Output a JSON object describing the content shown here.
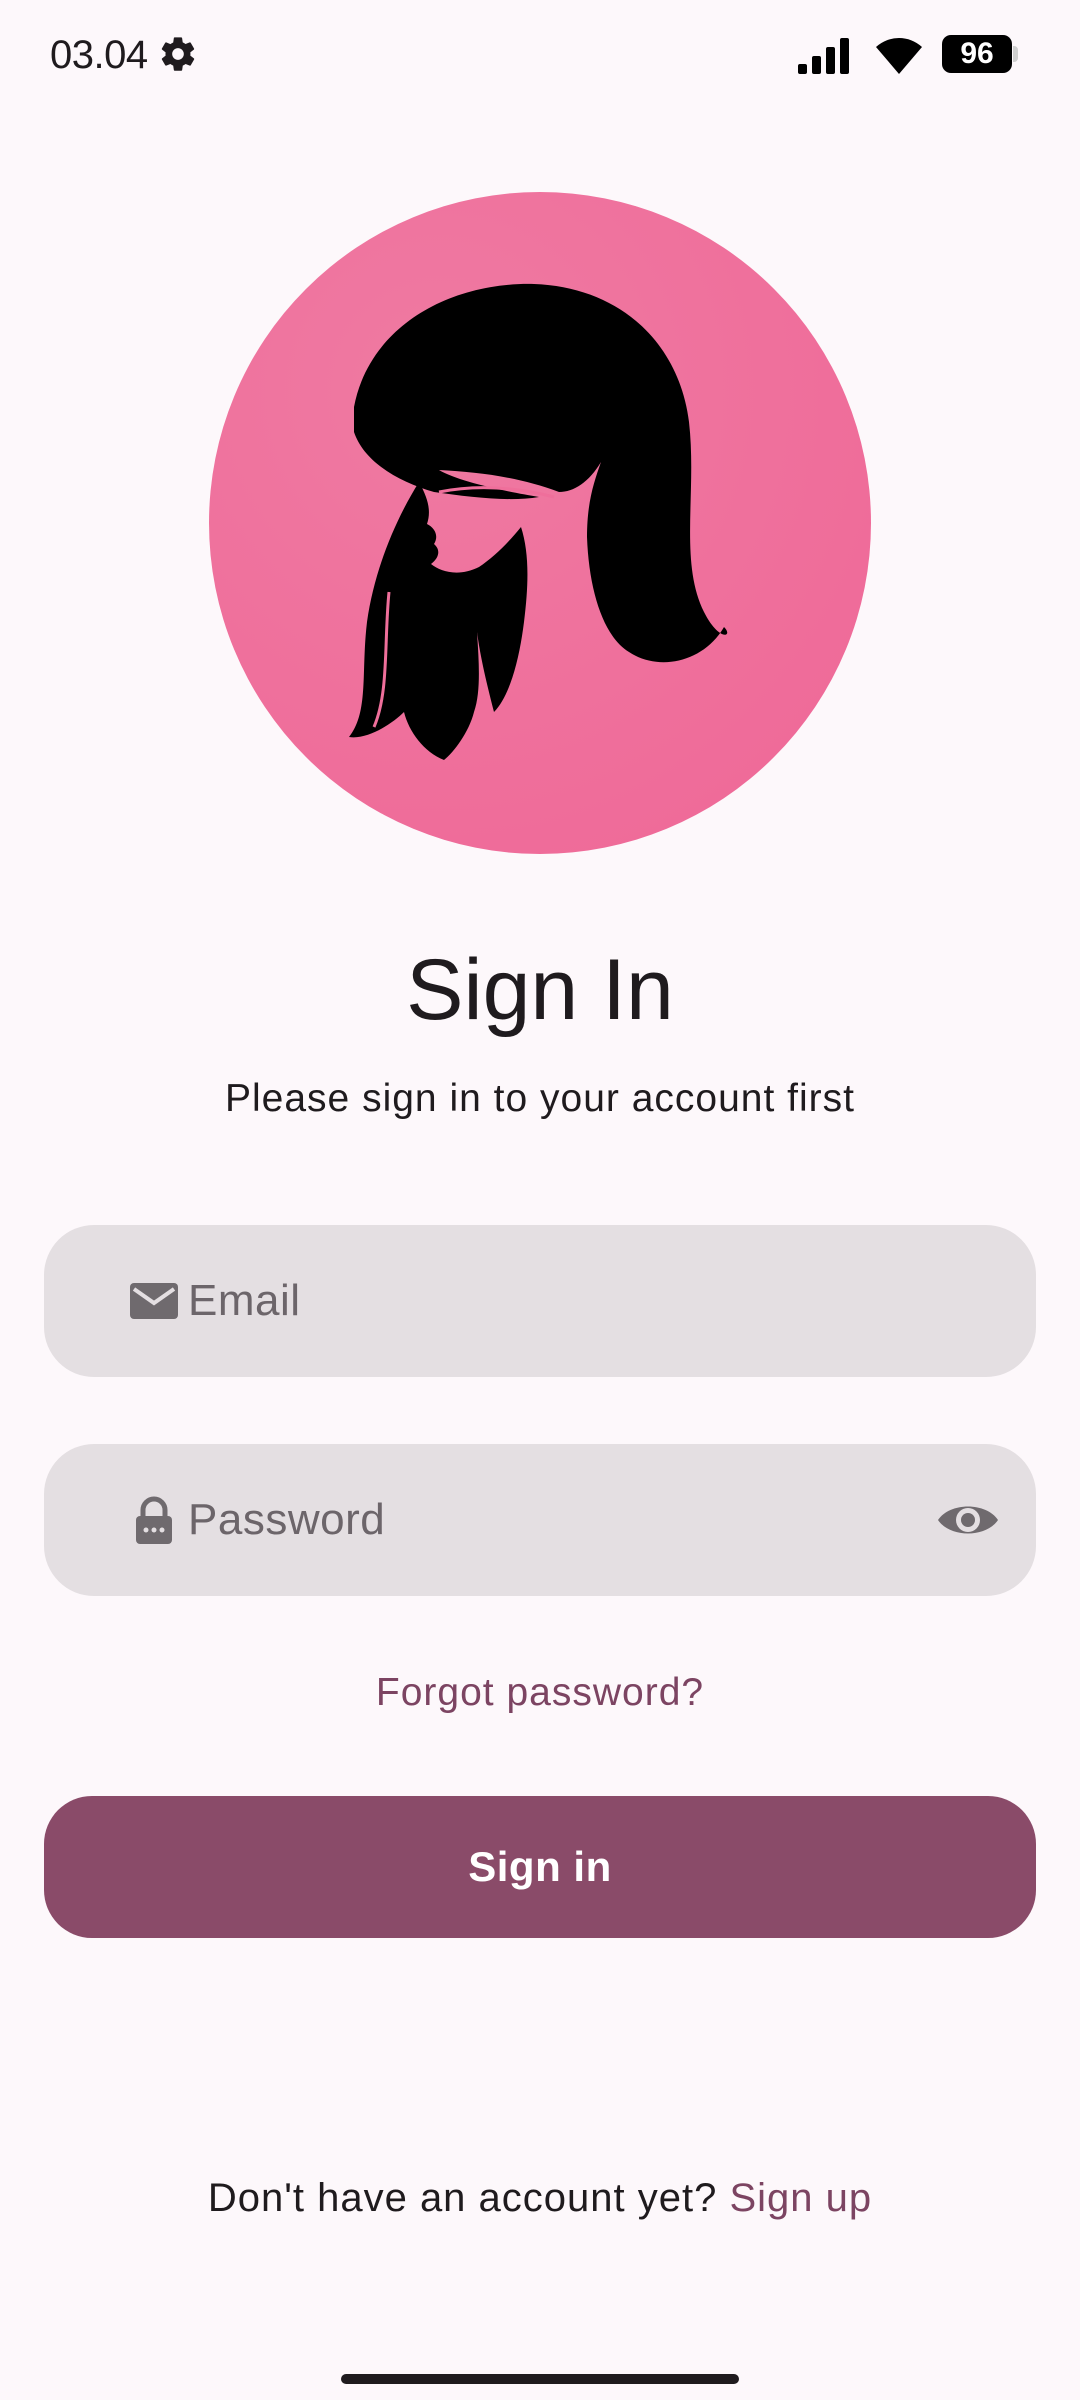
{
  "status_bar": {
    "time": "03.04",
    "battery_level": "96",
    "icons": [
      "gear-icon",
      "signal-icon",
      "wifi-icon",
      "battery-icon"
    ]
  },
  "avatar": {
    "icon": "woman-silhouette-icon",
    "background_color": "#ef6f9b"
  },
  "header": {
    "title": "Sign In",
    "subtitle": "Please sign in to your account first"
  },
  "form": {
    "email": {
      "placeholder": "Email",
      "value": "",
      "icon": "mail-icon"
    },
    "password": {
      "placeholder": "Password",
      "value": "",
      "icon": "lock-icon",
      "toggle_icon": "eye-icon"
    },
    "forgot_password_label": "Forgot password?",
    "submit_label": "Sign in"
  },
  "footer": {
    "prompt": "Don't have an account yet? ",
    "signup_label": "Sign up"
  },
  "colors": {
    "background": "#fdf8fb",
    "accent": "#8a4b69",
    "link": "#7c4462",
    "field_background": "#e4dfe2",
    "avatar_pink": "#ef6f9b"
  }
}
